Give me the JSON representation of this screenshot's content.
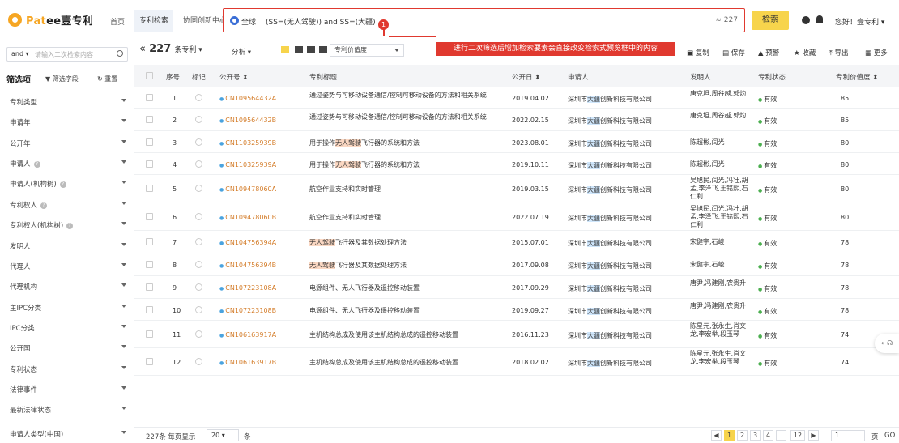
{
  "brand": {
    "name_prefix": "Pat",
    "name_suffix": "ee壹专利"
  },
  "nav": {
    "home": "首页",
    "tabs": [
      "专利检索",
      "协同创新中心"
    ]
  },
  "search": {
    "scope": "全球",
    "query": "(SS=(无人驾驶)) and SS=(大疆)",
    "count": "≈ 227",
    "button": "检索"
  },
  "user": {
    "greeting": "您好！壹专利 ▾"
  },
  "annotation": {
    "badge": "1",
    "note": "进行二次筛选后增加检索要素会直接改变检索式预览框中的内容"
  },
  "sidebar": {
    "search_mode": "and ▾",
    "search_placeholder": "请输入二次检索内容",
    "title": "筛选项",
    "filter_label": "▼ 筛选字段",
    "reset_label": "↻ 重置",
    "facets": [
      "专利类型",
      "申请年",
      "公开年",
      "申请人",
      "申请人(机构树)",
      "专利权人",
      "专利权人(机构树)",
      "发明人",
      "代理人",
      "代理机构",
      "主IPC分类",
      "IPC分类",
      "公开国",
      "专利状态",
      "法律事件",
      "最新法律状态",
      "申请人类型(中国)"
    ],
    "help_facets": [
      3,
      4,
      5,
      6
    ]
  },
  "toolbar": {
    "collapse": "«",
    "total_count": "227",
    "total_unit": "条专利 ▾",
    "analyze": "分析 ▾",
    "sort_select": "专利价值度",
    "copy": "复制",
    "save": "保存",
    "alert": "预警",
    "favorite": "收藏",
    "export": "导出",
    "more": "更多"
  },
  "table": {
    "headers": [
      "序号",
      "标记",
      "公开号 ⬍",
      "专利标题",
      "公开日 ⬍",
      "申请人",
      "发明人",
      "专利状态",
      "专利价值度 ⬍"
    ],
    "rows": [
      {
        "no": "1",
        "pn": "CN109564432A",
        "title": "通过姿势与可移动设备通信/控制可移动设备的方法和相关系统",
        "date": "2019.04.02",
        "app_pre": "深圳市",
        "app_hl": "大疆",
        "app_post": "创新科技有限公司",
        "inventor": "唐克坦,周谷越,郭灼",
        "status": "有效",
        "value": "85",
        "title_hl": ""
      },
      {
        "no": "2",
        "pn": "CN109564432B",
        "title": "通过姿势与可移动设备通信/控制可移动设备的方法和相关系统",
        "date": "2022.02.15",
        "app_pre": "深圳市",
        "app_hl": "大疆",
        "app_post": "创新科技有限公司",
        "inventor": "唐克坦,周谷越,郭灼",
        "status": "有效",
        "value": "85",
        "title_hl": ""
      },
      {
        "no": "3",
        "pn": "CN110325939B",
        "title_pre": "用于操作",
        "title_hl": "无人驾驶",
        "title_post": "飞行器的系统和方法",
        "date": "2023.08.01",
        "app_pre": "深圳市",
        "app_hl": "大疆",
        "app_post": "创新科技有限公司",
        "inventor": "陈超彬,闫光",
        "status": "有效",
        "value": "80"
      },
      {
        "no": "4",
        "pn": "CN110325939A",
        "title_pre": "用于操作",
        "title_hl": "无人驾驶",
        "title_post": "飞行器的系统和方法",
        "date": "2019.10.11",
        "app_pre": "深圳市",
        "app_hl": "大疆",
        "app_post": "创新科技有限公司",
        "inventor": "陈超彬,闫光",
        "status": "有效",
        "value": "80"
      },
      {
        "no": "5",
        "pn": "CN109478060A",
        "title": "航空作业支持和实时管理",
        "date": "2019.03.15",
        "app_pre": "深圳市",
        "app_hl": "大疆",
        "app_post": "创新科技有限公司",
        "inventor": "吴旭民,闫光,冯壮,胡孟,李泽飞,王铭熙,石仁利",
        "status": "有效",
        "value": "80",
        "title_hl": ""
      },
      {
        "no": "6",
        "pn": "CN109478060B",
        "title": "航空作业支持和实时管理",
        "date": "2022.07.19",
        "app_pre": "深圳市",
        "app_hl": "大疆",
        "app_post": "创新科技有限公司",
        "inventor": "吴旭民,闫光,冯壮,胡孟,李泽飞,王铭熙,石仁利",
        "status": "有效",
        "value": "80",
        "title_hl": ""
      },
      {
        "no": "7",
        "pn": "CN104756394A",
        "title_pre": "",
        "title_hl": "无人驾驶",
        "title_post": "飞行器及其数据处理方法",
        "date": "2015.07.01",
        "app_pre": "深圳市",
        "app_hl": "大疆",
        "app_post": "创新科技有限公司",
        "inventor": "宋健宇,石峻",
        "status": "有效",
        "value": "78"
      },
      {
        "no": "8",
        "pn": "CN104756394B",
        "title_pre": "",
        "title_hl": "无人驾驶",
        "title_post": "飞行器及其数据处理方法",
        "date": "2017.09.08",
        "app_pre": "深圳市",
        "app_hl": "大疆",
        "app_post": "创新科技有限公司",
        "inventor": "宋健宇,石峻",
        "status": "有效",
        "value": "78"
      },
      {
        "no": "9",
        "pn": "CN107223108A",
        "title": "电源组件、无人飞行器及遥控移动装置",
        "date": "2017.09.29",
        "app_pre": "深圳市",
        "app_hl": "大疆",
        "app_post": "创新科技有限公司",
        "inventor": "唐尹,冯建刚,农贵升",
        "status": "有效",
        "value": "78",
        "title_hl": ""
      },
      {
        "no": "10",
        "pn": "CN107223108B",
        "title": "电源组件、无人飞行器及遥控移动装置",
        "date": "2019.09.27",
        "app_pre": "深圳市",
        "app_hl": "大疆",
        "app_post": "创新科技有限公司",
        "inventor": "唐尹,冯建刚,农贵升",
        "status": "有效",
        "value": "78",
        "title_hl": ""
      },
      {
        "no": "11",
        "pn": "CN106163917A",
        "title": "主机结构总成及使用该主机结构总成的遥控移动装置",
        "date": "2016.11.23",
        "app_pre": "深圳市",
        "app_hl": "大疆",
        "app_post": "创新科技有限公司",
        "inventor": "陈星元,张永生,肖文龙,李宏举,段玉琴",
        "status": "有效",
        "value": "74",
        "title_hl": ""
      },
      {
        "no": "12",
        "pn": "CN106163917B",
        "title": "主机结构总成及使用该主机结构总成的遥控移动装置",
        "date": "2018.02.02",
        "app_pre": "深圳市",
        "app_hl": "大疆",
        "app_post": "创新科技有限公司",
        "inventor": "陈星元,张永生,肖文龙,李宏举,段玉琴",
        "status": "有效",
        "value": "74",
        "title_hl": ""
      }
    ]
  },
  "pager": {
    "total": "227条 每页显示",
    "page_size": "20 ▾",
    "unit": "条",
    "prev": "◀",
    "pages": [
      "1",
      "2",
      "3",
      "4",
      "...",
      "12"
    ],
    "next": "▶",
    "jump_value": "1",
    "page_label": "页",
    "go": "GO"
  },
  "float": {
    "label": "« ☊"
  }
}
